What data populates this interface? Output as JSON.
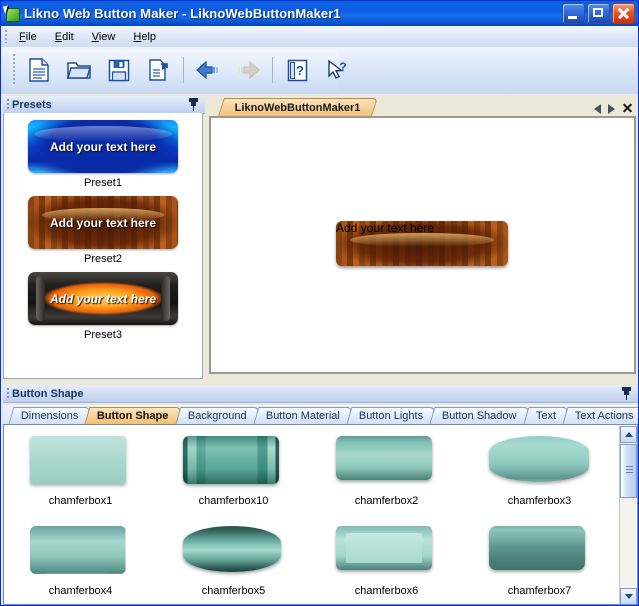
{
  "window": {
    "title": "Likno Web Button Maker  -  LiknoWebButtonMaker1",
    "app_icon": "likno-app-icon",
    "controls": {
      "minimize": "minimize-icon",
      "maximize": "maximize-icon",
      "close": "close-icon"
    },
    "accent_titlebar": "#0b5ae5",
    "accent_tab_active": "#f5bf70"
  },
  "menu": {
    "items": [
      {
        "label": "File",
        "mnemonic": "F"
      },
      {
        "label": "Edit",
        "mnemonic": "E"
      },
      {
        "label": "View",
        "mnemonic": "V"
      },
      {
        "label": "Help",
        "mnemonic": "H"
      }
    ]
  },
  "toolbar": {
    "buttons": [
      {
        "name": "new-document-button",
        "icon": "new-document-icon",
        "enabled": true
      },
      {
        "name": "open-file-button",
        "icon": "open-folder-icon",
        "enabled": true
      },
      {
        "name": "save-button",
        "icon": "floppy-save-icon",
        "enabled": true
      },
      {
        "name": "export-button",
        "icon": "export-arrow-icon",
        "enabled": true
      },
      {
        "name": "back-button",
        "icon": "arrow-left-icon",
        "enabled": true
      },
      {
        "name": "forward-button",
        "icon": "arrow-right-icon",
        "enabled": false
      },
      {
        "name": "help-topics-button",
        "icon": "help-document-icon",
        "enabled": true
      },
      {
        "name": "context-help-button",
        "icon": "help-cursor-icon",
        "enabled": true
      }
    ]
  },
  "presets_panel": {
    "title": "Presets",
    "pin_icon": "pin-icon",
    "grip_icon": "drag-grip-icon",
    "items": [
      {
        "label": "Preset1",
        "button_text": "Add your text here",
        "style": "blue-glass"
      },
      {
        "label": "Preset2",
        "button_text": "Add your text here",
        "style": "wood-texture"
      },
      {
        "label": "Preset3",
        "button_text": "Add your text here",
        "style": "dark-metal-orange"
      }
    ]
  },
  "document_area": {
    "tab_label": "LiknoWebButtonMaker1",
    "nav": {
      "prev": "nav-prev-icon",
      "next": "nav-next-icon",
      "close": "nav-close-icon"
    },
    "canvas_button": {
      "text": "Add your text here",
      "style": "wood-texture"
    }
  },
  "shape_panel": {
    "title": "Button Shape",
    "pin_icon": "pin-icon",
    "grip_icon": "drag-grip-icon",
    "tabs": [
      {
        "label": "Dimensions",
        "active": false
      },
      {
        "label": "Button Shape",
        "active": true
      },
      {
        "label": "Background",
        "active": false
      },
      {
        "label": "Button Material",
        "active": false
      },
      {
        "label": "Button Lights",
        "active": false
      },
      {
        "label": "Button Shadow",
        "active": false
      },
      {
        "label": "Text",
        "active": false
      },
      {
        "label": "Text Actions",
        "active": false
      }
    ],
    "shapes": [
      {
        "label": "chamferbox1",
        "shape_class": "s-box1"
      },
      {
        "label": "chamferbox10",
        "shape_class": "s-box10"
      },
      {
        "label": "chamferbox2",
        "shape_class": "s-box2"
      },
      {
        "label": "chamferbox3",
        "shape_class": "s-box3"
      },
      {
        "label": "chamferbox4",
        "shape_class": "s-box4"
      },
      {
        "label": "chamferbox5",
        "shape_class": "s-box5"
      },
      {
        "label": "chamferbox6",
        "shape_class": "s-box6"
      },
      {
        "label": "chamferbox7",
        "shape_class": "s-box7"
      }
    ],
    "scrollbar": {
      "up_icon": "scroll-up-icon",
      "down_icon": "scroll-down-icon",
      "thumb": "scroll-thumb"
    }
  }
}
